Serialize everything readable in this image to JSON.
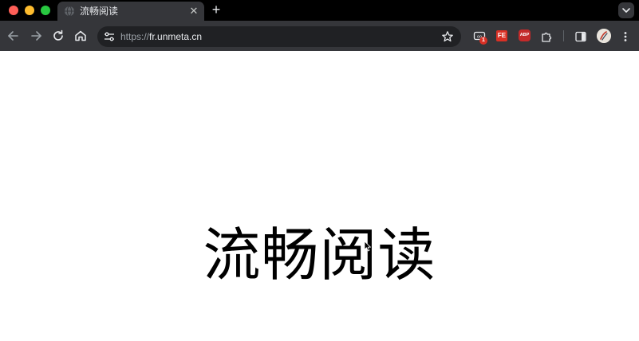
{
  "window": {
    "traffic_lights": [
      "close",
      "minimize",
      "maximize"
    ]
  },
  "tab": {
    "title": "流畅阅读",
    "favicon": "globe-icon",
    "close_icon": "close-icon"
  },
  "new_tab_icon": "plus-icon",
  "tab_search_icon": "chevron-down-icon",
  "toolbar": {
    "back_icon": "arrow-left-icon",
    "forward_icon": "arrow-right-icon",
    "reload_icon": "reload-icon",
    "home_icon": "home-icon"
  },
  "omnibox": {
    "url_protocol": "https://",
    "url_host": "fr.unmeta.cn",
    "site_info_icon": "tune-icon",
    "bookmark_icon": "star-icon"
  },
  "extensions": {
    "reader_badge": "1",
    "fe_label": "FE",
    "abp_label": "ABP",
    "puzzle_icon": "puzzle-icon",
    "sidepanel_icon": "side-panel-icon"
  },
  "colors": {
    "tabstrip_bg": "#000000",
    "toolbar_bg": "#35363a",
    "omnibox_bg": "#202124",
    "badge_red": "#d93025"
  },
  "page": {
    "hero_title": "流畅阅读"
  }
}
